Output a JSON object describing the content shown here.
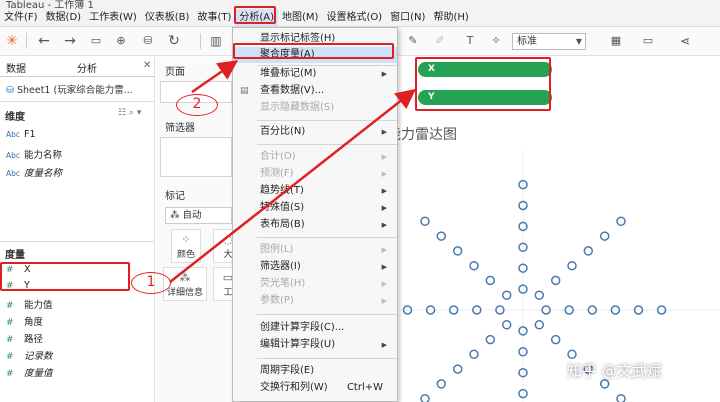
{
  "window": {
    "title": "Tableau - 工作簿 1"
  },
  "menubar": {
    "items": [
      {
        "label": "文件(F)"
      },
      {
        "label": "数据(D)"
      },
      {
        "label": "工作表(W)"
      },
      {
        "label": "仪表板(B)"
      },
      {
        "label": "故事(T)"
      },
      {
        "label": "分析(A)"
      },
      {
        "label": "地图(M)"
      },
      {
        "label": "设置格式(O)"
      },
      {
        "label": "窗口(N)"
      },
      {
        "label": "帮助(H)"
      }
    ]
  },
  "toolbar": {
    "fit_select": "标准"
  },
  "left_panel": {
    "tab_data": "数据",
    "tab_analysis": "分析",
    "datasource": "Sheet1 (玩家综合能力雷...",
    "dimensions_title": "维度",
    "dimensions": [
      {
        "icon": "Abc",
        "label": "F1",
        "italic": false
      },
      {
        "icon": "Abc",
        "label": "能力名称",
        "italic": false
      },
      {
        "icon": "Abc",
        "label": "度量名称",
        "italic": true
      }
    ],
    "measures_title": "度量",
    "measures": [
      {
        "icon": "#",
        "label": "X",
        "italic": false
      },
      {
        "icon": "#",
        "label": "Y",
        "italic": false
      },
      {
        "icon": "#",
        "label": "能力值",
        "italic": false
      },
      {
        "icon": "#",
        "label": "角度",
        "italic": false
      },
      {
        "icon": "#",
        "label": "路径",
        "italic": false
      },
      {
        "icon": "#",
        "label": "记录数",
        "italic": true
      },
      {
        "icon": "#",
        "label": "度量值",
        "italic": true
      }
    ]
  },
  "shelves": {
    "pages": "页面",
    "filters": "筛选器",
    "marks": "标记",
    "mark_type": "自动",
    "color": "颜色",
    "size": "大",
    "detail": "详细信息",
    "tooltip": "工"
  },
  "pills": {
    "columns": "X",
    "rows": "Y"
  },
  "view": {
    "title": "能力雷达图"
  },
  "watermark": "知乎 @文武斌",
  "dropdown": {
    "items": [
      {
        "label": "显示标记标签(H)",
        "disabled": false
      },
      {
        "label": "聚合度量(A)",
        "disabled": false,
        "highlight": true
      },
      {
        "label": "堆叠标记(M)",
        "disabled": false,
        "submenu": true
      },
      {
        "label": "查看数据(V)...",
        "disabled": false
      },
      {
        "label": "显示隐藏数据(S)",
        "disabled": true
      },
      {
        "label": "百分比(N)",
        "disabled": false,
        "submenu": true
      },
      {
        "label": "合计(O)",
        "disabled": true,
        "submenu": true
      },
      {
        "label": "预测(F)",
        "disabled": true,
        "submenu": true
      },
      {
        "label": "趋势线(T)",
        "disabled": false,
        "submenu": true
      },
      {
        "label": "特殊值(S)",
        "disabled": false,
        "submenu": true
      },
      {
        "label": "表布局(B)",
        "disabled": false,
        "submenu": true
      },
      {
        "label": "图例(L)",
        "disabled": true,
        "submenu": true
      },
      {
        "label": "筛选器(I)",
        "disabled": false,
        "submenu": true
      },
      {
        "label": "荧光笔(H)",
        "disabled": true,
        "submenu": true
      },
      {
        "label": "参数(P)",
        "disabled": true,
        "submenu": true
      },
      {
        "label": "创建计算字段(C)...",
        "disabled": false
      },
      {
        "label": "编辑计算字段(U)",
        "disabled": false,
        "submenu": true
      },
      {
        "label": "周期字段(E)",
        "disabled": false
      },
      {
        "label": "交换行和列(W)",
        "disabled": false,
        "shortcut": "Ctrl+W"
      }
    ]
  },
  "annotations": {
    "marker_1": "1",
    "marker_2": "2"
  },
  "colors": {
    "accent_red": "#e02020",
    "pill_green": "#26a254",
    "point_blue": "#4a78b0"
  }
}
